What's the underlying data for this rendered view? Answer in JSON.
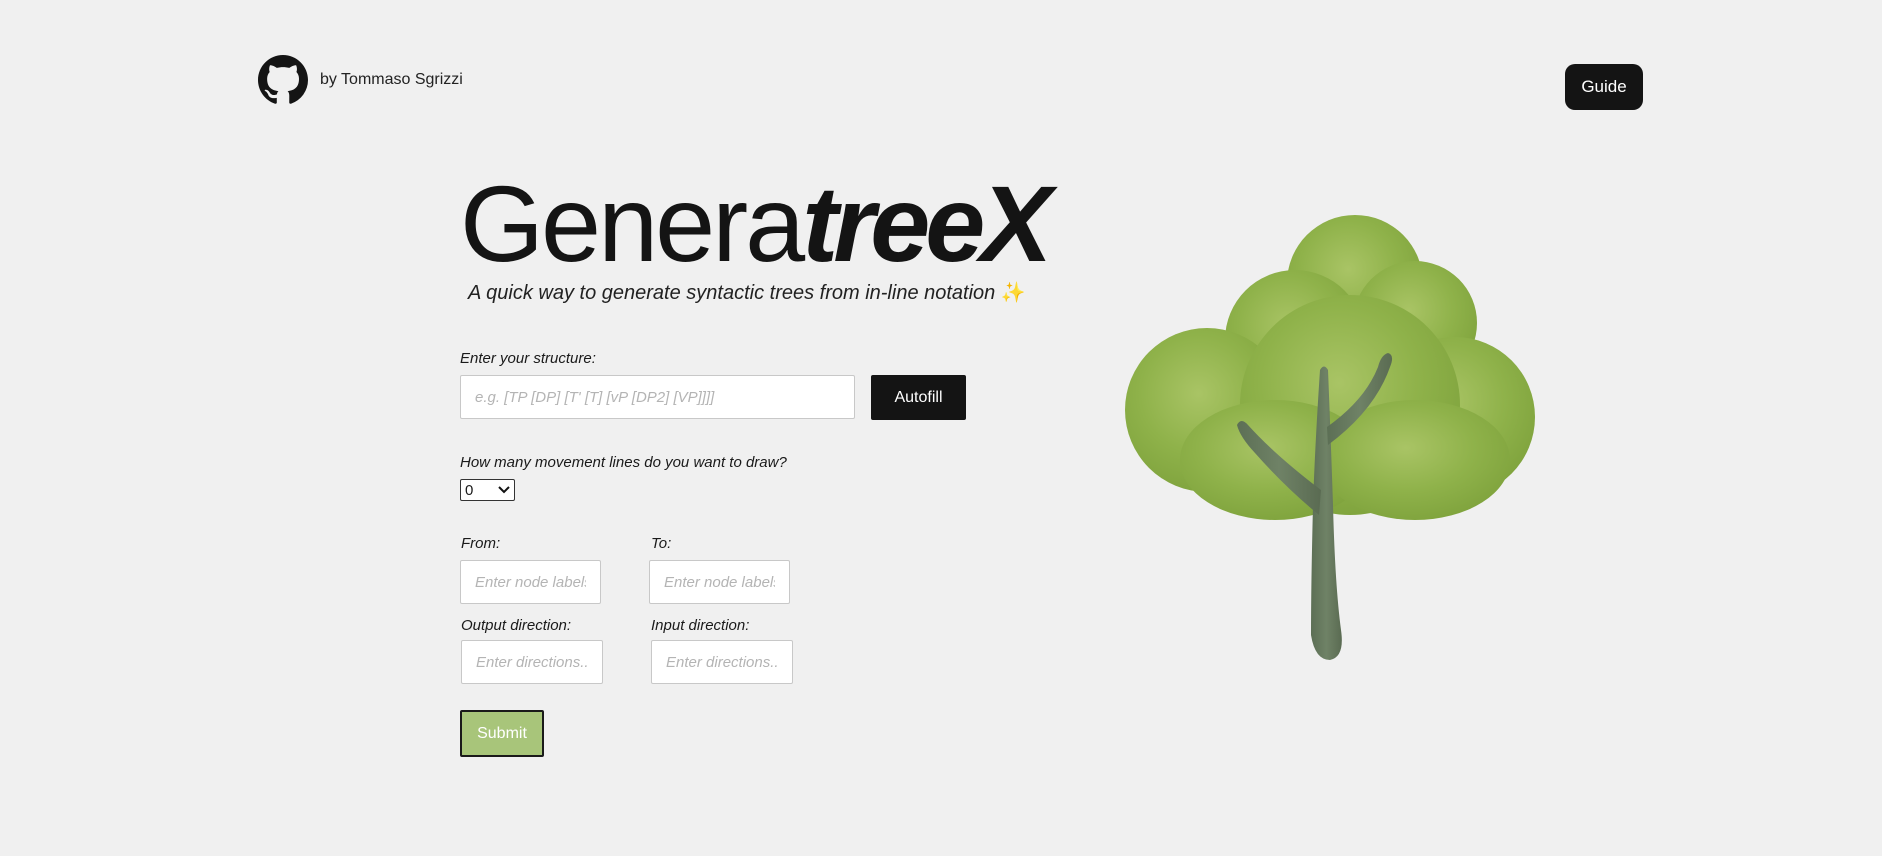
{
  "header": {
    "author": "by Tommaso Sgrizzi",
    "guide_label": "Guide"
  },
  "hero": {
    "title_regular": "Genera",
    "title_italic": "treeX",
    "subtitle": "A quick way to generate syntactic trees from in-line notation",
    "subtitle_emoji": "✨"
  },
  "form": {
    "structure_label": "Enter your structure:",
    "structure_placeholder": "e.g. [TP [DP] [T' [T] [vP [DP2] [VP]]]]",
    "autofill_label": "Autofill",
    "movement_label": "How many movement lines do you want to draw?",
    "movement_count": "0",
    "from_label": "From:",
    "from_placeholder": "Enter node labels",
    "to_label": "To:",
    "to_placeholder": "Enter node labels",
    "output_label": "Output direction:",
    "output_placeholder": "Enter directions...",
    "input_label": "Input direction:",
    "input_placeholder": "Enter directions...",
    "submit_label": "Submit"
  },
  "colors": {
    "background": "#f0f0f0",
    "button_dark": "#141414",
    "submit_green": "#a8c57a",
    "foliage": "#8fb24a",
    "trunk": "#66785d"
  },
  "icons": {
    "github": "github-icon",
    "dropdown": "chevron-down-icon",
    "tree": "tree-illustration"
  }
}
